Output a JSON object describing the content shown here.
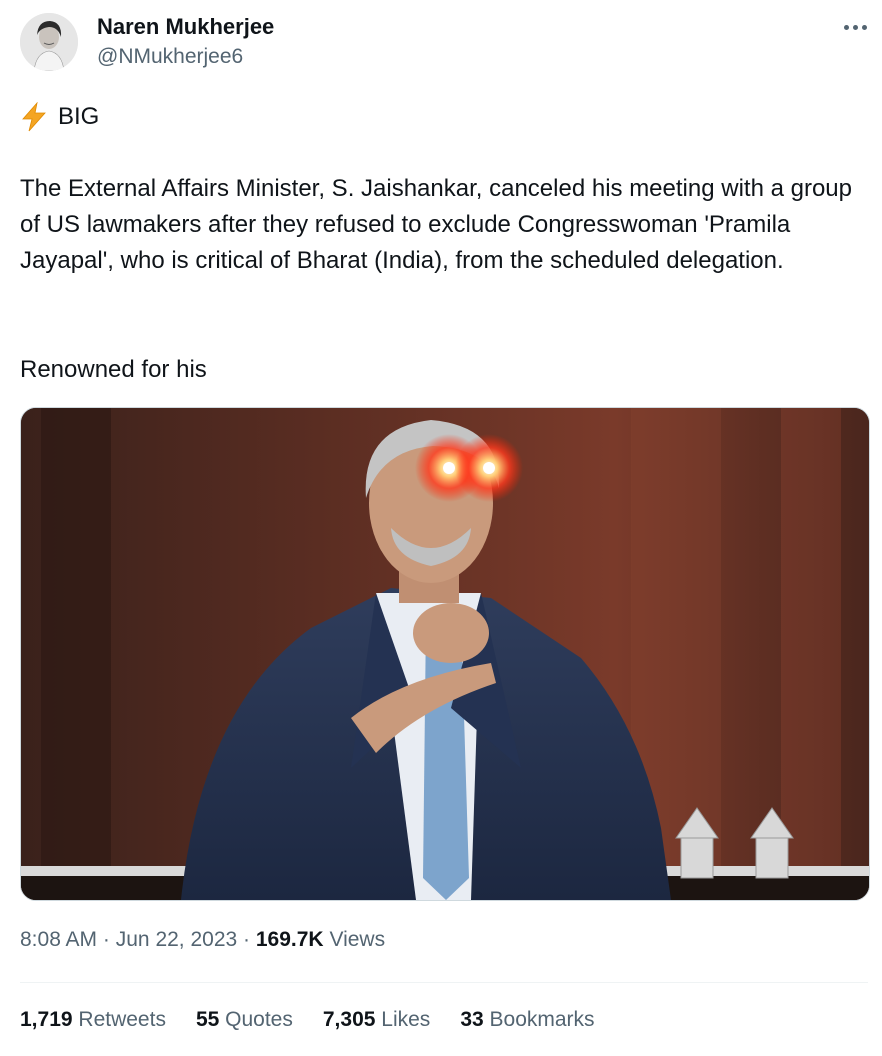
{
  "author": {
    "name": "Naren Mukherjee",
    "handle": "@NMukherjee6"
  },
  "tweet": {
    "lead_icon": "lightning-bolt-emoji",
    "lead": "BIG",
    "body": "The External Affairs Minister, S. Jaishankar, canceled his meeting with a group of US lawmakers after they refused to exclude Congresswoman 'Pramila Jayapal', who is critical of Bharat (India), from the scheduled delegation.",
    "body2": "Renowned for his"
  },
  "meta": {
    "time": "8:08 AM",
    "separator": "·",
    "date": "Jun 22, 2023",
    "views_count": "169.7K",
    "views_label": "Views"
  },
  "stats": [
    {
      "num": "1,719",
      "label": "Retweets"
    },
    {
      "num": "55",
      "label": "Quotes"
    },
    {
      "num": "7,305",
      "label": "Likes"
    },
    {
      "num": "33",
      "label": "Bookmarks"
    }
  ],
  "colors": {
    "text": "#0f1419",
    "secondary": "#536471",
    "divider": "#eff3f4"
  }
}
